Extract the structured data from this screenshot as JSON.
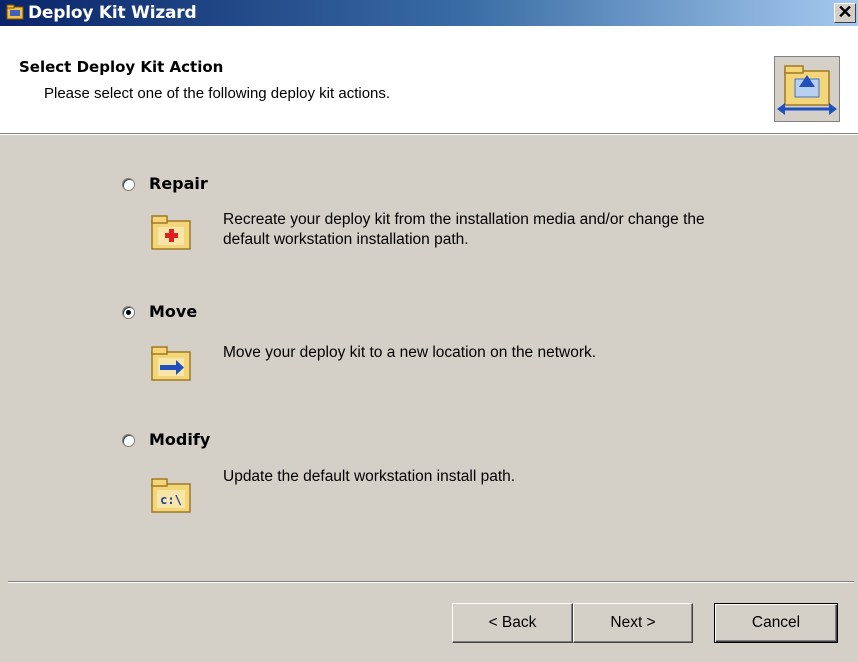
{
  "window": {
    "title": "Deploy Kit Wizard",
    "close_label": "✕"
  },
  "header": {
    "title": "Select Deploy Kit Action",
    "subtitle": "Please select one of the following deploy kit actions."
  },
  "options": [
    {
      "label": "Repair",
      "selected": false,
      "desc_line1": "Recreate your deploy kit from the installation media and/or change the",
      "desc_line2": "default workstation installation path.",
      "icon": "repair-folder-icon"
    },
    {
      "label": "Move",
      "selected": true,
      "desc_line1": "Move your deploy kit to a new location on the network.",
      "icon": "move-folder-icon"
    },
    {
      "label": "Modify",
      "selected": false,
      "desc_line1": "Update the default workstation install path.",
      "icon": "modify-folder-icon",
      "icon_text": "c:\\"
    }
  ],
  "buttons": {
    "back": "< Back",
    "next": "Next >",
    "cancel": "Cancel"
  }
}
